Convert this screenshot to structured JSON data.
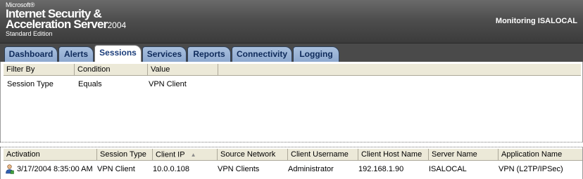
{
  "banner": {
    "brand_small": "Microsoft®",
    "product_line1": "Internet Security &",
    "product_line2": "Acceleration Server",
    "product_year": "2004",
    "edition": "Standard Edition",
    "monitoring": "Monitoring ISALOCAL"
  },
  "tabs": [
    {
      "label": "Dashboard",
      "active": false
    },
    {
      "label": "Alerts",
      "active": false
    },
    {
      "label": "Sessions",
      "active": true
    },
    {
      "label": "Services",
      "active": false
    },
    {
      "label": "Reports",
      "active": false
    },
    {
      "label": "Connectivity",
      "active": false
    },
    {
      "label": "Logging",
      "active": false
    }
  ],
  "filter": {
    "headers": [
      "Filter By",
      "Condition",
      "Value"
    ],
    "rows": [
      {
        "filter_by": "Session Type",
        "condition": "Equals",
        "value": "VPN Client"
      }
    ]
  },
  "sessions": {
    "columns": [
      "Activation",
      "Session Type",
      "Client IP",
      "Source Network",
      "Client Username",
      "Client Host Name",
      "Server Name",
      "Application Name"
    ],
    "sorted_column_icon": "sort-ascending-icon",
    "rows": [
      {
        "icon": "vpn-user-icon",
        "activation": "3/17/2004 8:35:00 AM",
        "session_type": "VPN Client",
        "client_ip": "10.0.0.108",
        "source_network": "VPN Clients",
        "client_username": "Administrator",
        "client_host_name": "192.168.1.90",
        "server_name": "ISALOCAL",
        "application_name": "VPN (L2TP/IPSec)"
      }
    ]
  }
}
